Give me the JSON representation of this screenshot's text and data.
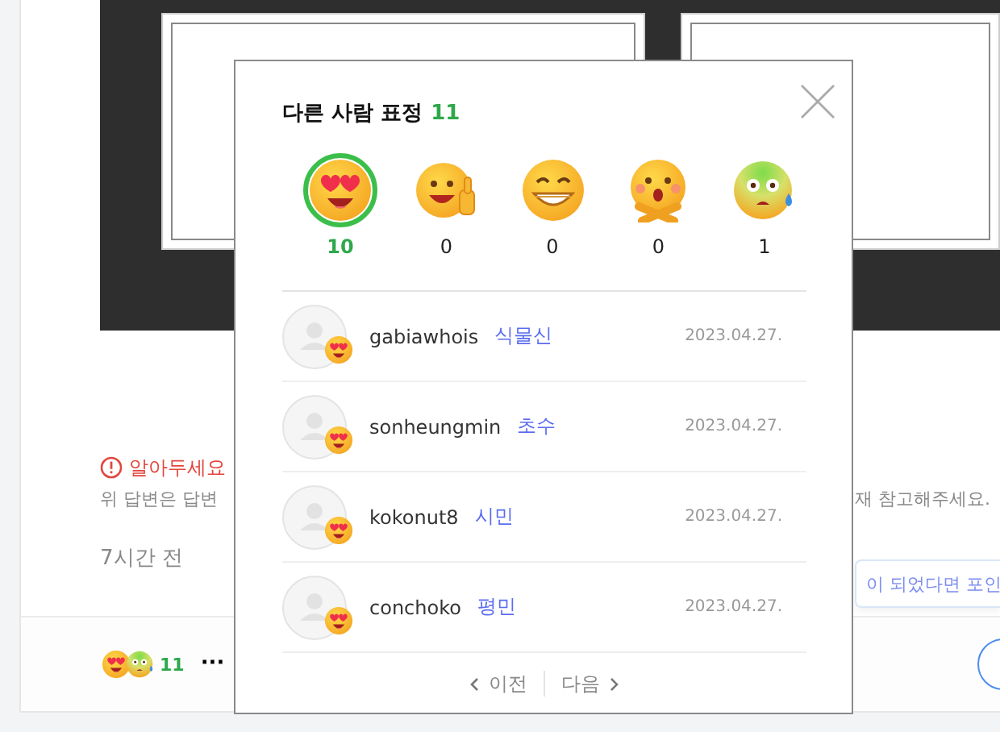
{
  "post": {
    "notice": {
      "title": "알아두세요",
      "text_left": "위 답변은 답변",
      "text_right": "재 참고해주세요."
    },
    "time": "7시간 전",
    "banner": {
      "text": "이 되었다면 포인"
    },
    "footer": {
      "reactions": [
        {
          "kind": "heart_eyes"
        },
        {
          "kind": "sweat"
        }
      ],
      "count": "11",
      "more": "···"
    }
  },
  "popup": {
    "title": "다른 사람 표정",
    "total": "11",
    "reactions": [
      {
        "kind": "heart_eyes",
        "count": "10",
        "selected": true
      },
      {
        "kind": "thumbs_up",
        "count": "0",
        "selected": false
      },
      {
        "kind": "grin",
        "count": "0",
        "selected": false
      },
      {
        "kind": "crossed_arms",
        "count": "0",
        "selected": false
      },
      {
        "kind": "sweat",
        "count": "1",
        "selected": false
      }
    ],
    "users": [
      {
        "name": "gabiawhois",
        "grade": "식물신",
        "date": "2023.04.27.",
        "reaction": {
          "kind": "heart_eyes"
        }
      },
      {
        "name": "sonheungmin",
        "grade": "초수",
        "date": "2023.04.27.",
        "reaction": {
          "kind": "heart_eyes"
        }
      },
      {
        "name": "kokonut8",
        "grade": "시민",
        "date": "2023.04.27.",
        "reaction": {
          "kind": "heart_eyes"
        }
      },
      {
        "name": "conchoko",
        "grade": "평민",
        "date": "2023.04.27.",
        "reaction": {
          "kind": "heart_eyes"
        }
      }
    ],
    "pager": {
      "prev": "이전",
      "next": "다음"
    }
  }
}
